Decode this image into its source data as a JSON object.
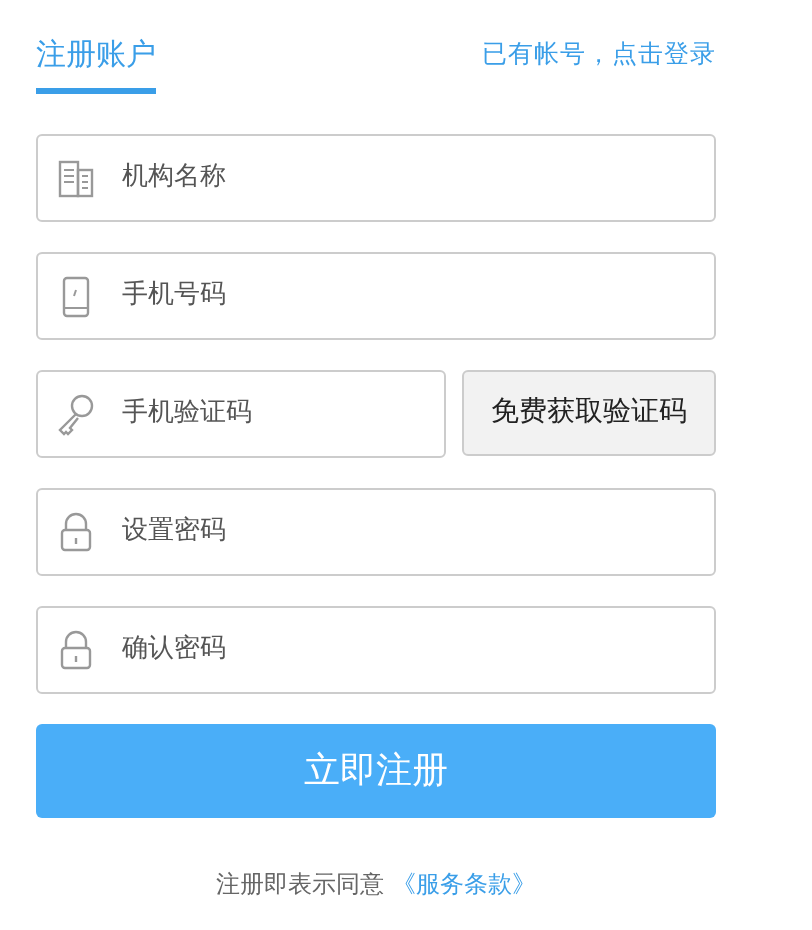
{
  "header": {
    "tab": {
      "label": "注册账户",
      "selected": true
    },
    "login_link": "已有帐号，点击登录"
  },
  "fields": [
    {
      "kind": "building",
      "placeholder": "机构名称"
    },
    {
      "kind": "phone",
      "placeholder": "手机号码"
    },
    {
      "kind": "key",
      "placeholder": "手机验证码",
      "button": "免费获取验证码"
    },
    {
      "kind": "lock",
      "placeholder": "设置密码"
    },
    {
      "kind": "lock",
      "placeholder": "确认密码"
    }
  ],
  "submit": "立即注册",
  "agreement": {
    "text": "注册即表示同意",
    "link": "《服务条款》"
  }
}
